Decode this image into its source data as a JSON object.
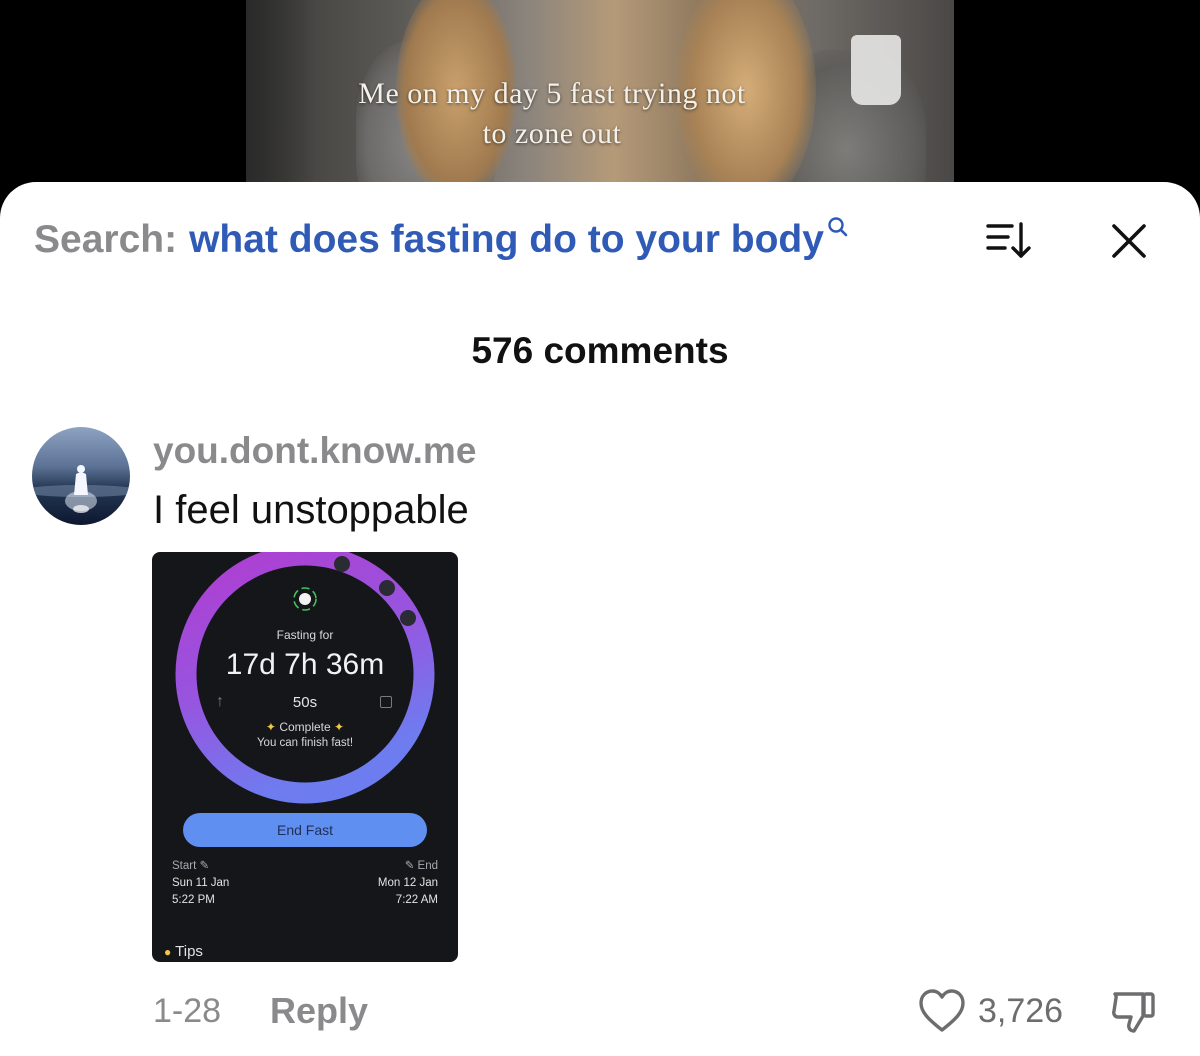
{
  "video": {
    "caption_line1": "Me on my day 5 fast trying not",
    "caption_line2": "to zone out"
  },
  "header": {
    "search_prefix": "Search:",
    "search_query": "what does fasting do to your body",
    "icons": [
      "search-icon",
      "sort-icon",
      "close-icon"
    ]
  },
  "comments_count": "576 comments",
  "comment": {
    "username": "you.dont.know.me",
    "text": "I feel unstoppable",
    "date": "1-28",
    "reply_label": "Reply",
    "likes": "3,726",
    "attachment": {
      "fasting_label": "Fasting for",
      "fasting_time": "17d 7h 36m",
      "seconds": "50s",
      "complete_label": "Complete",
      "finish_text": "You can finish fast!",
      "end_button": "End Fast",
      "start_label": "Start",
      "start_date": "Sun 11 Jan",
      "start_time": "5:22 PM",
      "end_label": "End",
      "end_date": "Mon 12 Jan",
      "end_time": "7:22 AM",
      "tips_label": "Tips",
      "progress": 1.0
    }
  },
  "colors": {
    "query_blue": "#2f5ab6",
    "muted_gray": "#8a8a8c",
    "end_button_blue": "#5f8ff0",
    "ring_purple": "#b13cd0",
    "ring_blue": "#6d7df0"
  }
}
